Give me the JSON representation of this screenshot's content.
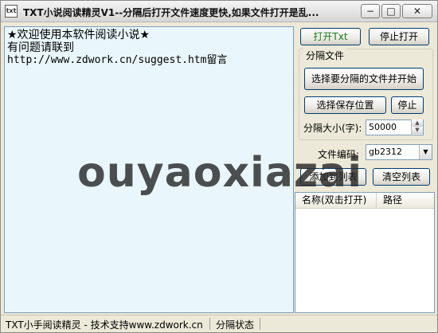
{
  "window": {
    "title": "TXT小说阅读精灵V1--分隔后打开文件速度更快,如果文件打开是乱...",
    "app_icon_text": "txt",
    "minimize_glyph": "−",
    "maximize_glyph": "□",
    "close_glyph": "✕"
  },
  "reader": {
    "lines": [
      "★欢迎使用本软件阅读小说★",
      "有问题请联到",
      "http://www.zdwork.cn/suggest.htm留言"
    ]
  },
  "toolbar": {
    "open_txt": "打开Txt",
    "stop_open": "停止打开"
  },
  "split": {
    "group_label": "分隔文件",
    "choose_file": "选择要分隔的文件并开始",
    "choose_save": "选择保存位置",
    "stop": "停止",
    "size_label": "分隔大小(字):",
    "size_value": "50000"
  },
  "encoding": {
    "label": "文件编码:",
    "value": "gb2312"
  },
  "list": {
    "add": "添加到列表",
    "clear": "清空列表",
    "columns": [
      "名称(双击打开)",
      "路径"
    ]
  },
  "status": {
    "support": "TXT小手阅读精灵 - 技术支持www.zdwork.cn",
    "split_state": "分隔状态"
  },
  "watermark": "ouyaoxiazai"
}
